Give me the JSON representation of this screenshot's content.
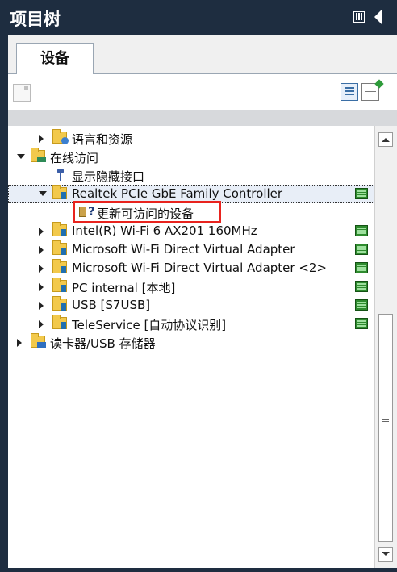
{
  "title": "项目树",
  "tab": {
    "label": "设备"
  },
  "tree": {
    "language": "语言和资源",
    "online_access": "在线访问",
    "show_hidden": "显示隐藏接口",
    "realtek": "Realtek PCIe GbE Family Controller",
    "update_accessible": "更新可访问的设备",
    "intel": "Intel(R) Wi-Fi 6 AX201 160MHz",
    "ms_direct": "Microsoft Wi-Fi Direct Virtual Adapter",
    "ms_direct2": "Microsoft Wi-Fi Direct Virtual Adapter <2>",
    "pc_internal": "PC internal [本地]",
    "usb": "USB [S7USB]",
    "teleservice": "TeleService [自动协议识别]",
    "card_reader": "读卡器/USB 存储器"
  },
  "icons": {
    "collapse": "panel-collapse-icon",
    "arrow": "collapse-arrow-icon",
    "new_device": "add-device-icon",
    "list_view": "list-view-icon",
    "grid_view": "grid-view-icon"
  },
  "colors": {
    "titlebar": "#1e2d40",
    "highlight": "#e8231e",
    "status_ok": "#2e8b2e"
  }
}
